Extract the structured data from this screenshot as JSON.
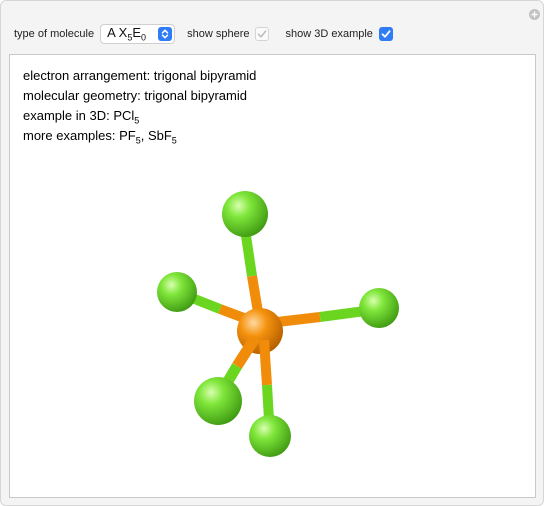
{
  "controls": {
    "type_label": "type of molecule",
    "select_value": {
      "prefix": "A X",
      "sub1": "5",
      "mid": "E",
      "sub2": "0"
    },
    "sphere_label": "show sphere",
    "sphere_checked": true,
    "example_label": "show 3D example",
    "example_checked": true
  },
  "info": {
    "line1": "electron arrangement: trigonal bipyramid",
    "line2": "molecular geometry: trigonal bipyramid",
    "line3_prefix": "example in 3D: PCl",
    "line3_sub": "5",
    "line4_prefix": "more examples: PF",
    "line4_sub1": "5",
    "line4_mid": ", SbF",
    "line4_sub2": "5"
  },
  "colors": {
    "central_atom": "#f08c0a",
    "ligand_atom": "#6ad620",
    "accent": "#2f7cf6"
  },
  "icons": [
    "plus-icon",
    "chevron-updown-icon",
    "checkmark-icon"
  ]
}
